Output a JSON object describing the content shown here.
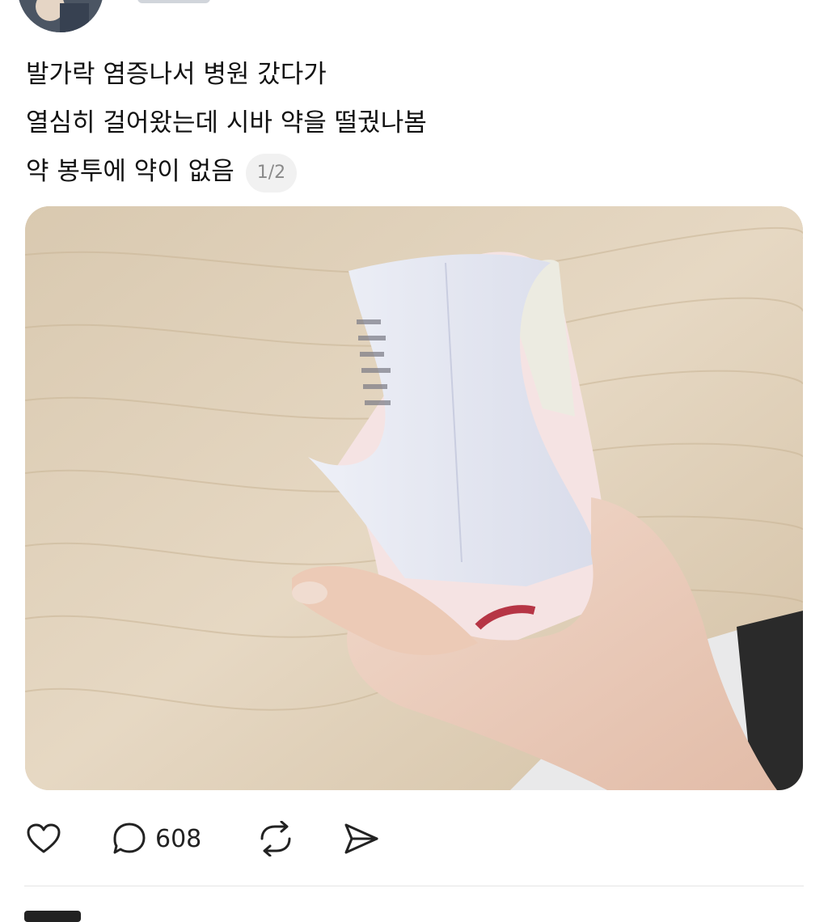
{
  "post": {
    "lines": [
      "발가락 염증나서 병원 갔다가",
      "열심히 걸어왔는데 시바 약을 떨궜나봄",
      "약 봉투에 약이 없음"
    ],
    "media_counter": "1/2"
  },
  "actions": {
    "like_icon": "heart-icon",
    "reply_icon": "speech-bubble-icon",
    "reply_count": "608",
    "repost_icon": "repost-arrows-icon",
    "share_icon": "paper-plane-icon"
  },
  "colors": {
    "text": "#111111",
    "muted": "#8a8a8a",
    "counter_bg": "#f1f1f1",
    "divider": "#e5e5e5"
  }
}
